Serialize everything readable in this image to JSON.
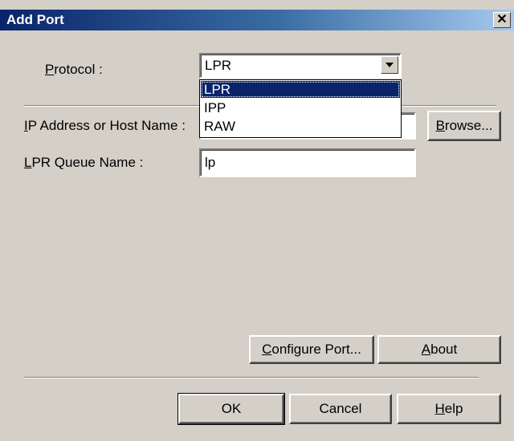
{
  "window": {
    "title": "Add Port",
    "close_glyph": "✕"
  },
  "protocol": {
    "label_prefix": "",
    "label_accel": "P",
    "label_rest": "rotocol :",
    "selected": "LPR",
    "options": [
      "LPR",
      "IPP",
      "RAW"
    ],
    "highlighted_index": 0
  },
  "ip_address": {
    "label_accel": "I",
    "label_rest": "P Address or Host Name :",
    "value": ""
  },
  "queue": {
    "label_accel": "L",
    "label_rest": "PR Queue Name :",
    "value": "lp"
  },
  "buttons": {
    "browse": {
      "accel": "B",
      "rest": "rowse..."
    },
    "configure_port": {
      "accel": "C",
      "rest": "onfigure Port..."
    },
    "about": {
      "accel": "A",
      "rest": "bout"
    },
    "ok": "OK",
    "cancel": "Cancel",
    "help": {
      "accel": "H",
      "rest": "elp"
    }
  }
}
